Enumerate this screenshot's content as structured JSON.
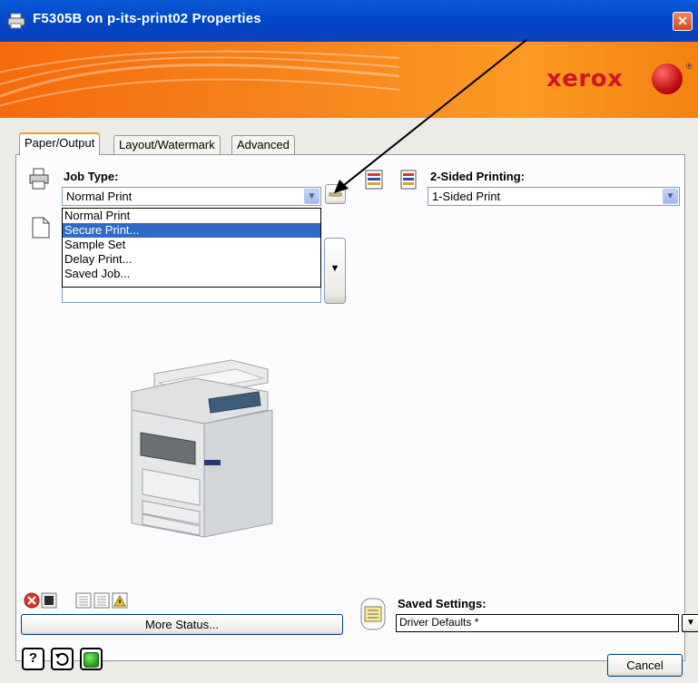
{
  "window": {
    "title": "F5305B on p-its-print02 Properties",
    "close_glyph": "✕"
  },
  "banner": {
    "brand": "xerox",
    "registered": "®",
    "accent": "#f7861c",
    "brand_color": "#d2161e"
  },
  "tabs": [
    {
      "label": "Paper/Output",
      "active": true
    },
    {
      "label": "Layout/Watermark",
      "active": false
    },
    {
      "label": "Advanced",
      "active": false
    }
  ],
  "job_type": {
    "label": "Job Type:",
    "value": "Normal Print",
    "options": [
      "Normal Print",
      "Secure Print...",
      "Sample Set",
      "Delay Print...",
      "Saved Job..."
    ],
    "selected_index": 1
  },
  "two_sided": {
    "label": "2-Sided Printing:",
    "value": "1-Sided Print"
  },
  "status": {
    "more_status_label": "More Status..."
  },
  "saved_settings": {
    "label": "Saved Settings:",
    "value": "Driver Defaults *"
  },
  "footer": {
    "help_glyph": "?",
    "cancel_label": "Cancel"
  },
  "icons": [
    "printer-icon",
    "page-icon",
    "setup-icon",
    "duplex-icon",
    "error-icon",
    "status-icon",
    "warning-icon",
    "saved-settings-icon",
    "help-icon",
    "restore-icon",
    "device-icon",
    "printer-image"
  ]
}
